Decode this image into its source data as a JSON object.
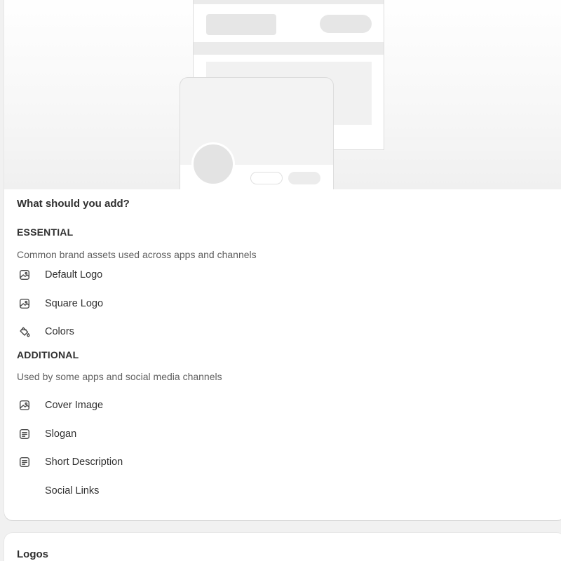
{
  "content": {
    "heading": "What should you add?",
    "essential": {
      "title": "ESSENTIAL",
      "description": "Common brand assets used across apps and channels",
      "items": [
        {
          "label": "Default Logo",
          "icon": "image-icon"
        },
        {
          "label": "Square Logo",
          "icon": "image-icon"
        },
        {
          "label": "Colors",
          "icon": "paint-bucket-icon"
        }
      ]
    },
    "additional": {
      "title": "ADDITIONAL",
      "description": "Used by some apps and social media channels",
      "items": [
        {
          "label": "Cover Image",
          "icon": "image-icon"
        },
        {
          "label": "Slogan",
          "icon": "text-block-icon"
        },
        {
          "label": "Short Description",
          "icon": "text-block-icon"
        },
        {
          "label": "Social Links",
          "icon": ""
        }
      ]
    }
  },
  "logos_card": {
    "title": "Logos"
  },
  "colors": {
    "page_background": "#f1f1f1",
    "card_background": "#ffffff",
    "text_primary": "#303030",
    "text_secondary": "#616161",
    "placeholder_gray": "#e6e6e6"
  }
}
